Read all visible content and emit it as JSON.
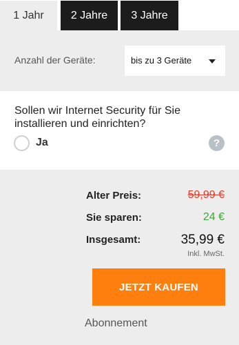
{
  "tabs": [
    {
      "label": "1 Jahr",
      "active": true
    },
    {
      "label": "2 Jahre",
      "active": false
    },
    {
      "label": "3 Jahre",
      "active": false
    }
  ],
  "devices": {
    "label": "Anzahl der Geräte:",
    "selected": "bis zu 3 Geräte"
  },
  "install": {
    "question": "Sollen wir Internet Security für Sie installieren und einrichten?",
    "option_label": "Ja",
    "help_symbol": "?"
  },
  "pricing": {
    "old_price_label": "Alter Preis:",
    "old_price": "59,99 €",
    "savings_label": "Sie sparen:",
    "savings": "24 €",
    "total_label": "Insgesamt:",
    "total": "35,99 €",
    "vat_note": "Inkl. MwSt."
  },
  "buy_button_label": "JETZT KAUFEN",
  "subscription_label": "Abonnement",
  "colors": {
    "accent": "#ff7f0e",
    "old_price": "#e8382a",
    "savings": "#3aa935",
    "tab_dark": "#1c1c1c"
  },
  "icons": {
    "dropdown": "chevron-down-icon",
    "help": "help-icon",
    "radio": "radio-icon"
  }
}
